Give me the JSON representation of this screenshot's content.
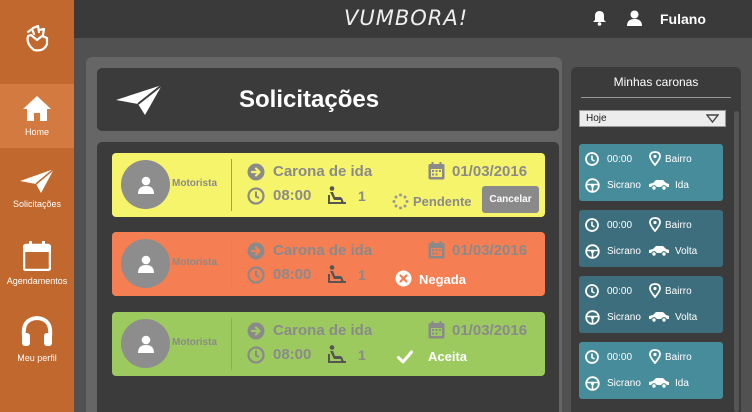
{
  "app": {
    "title": "VUMBORA!"
  },
  "topbar": {
    "user_name": "Fulano"
  },
  "sidebar": {
    "items": [
      {
        "label": "Home",
        "icon": "home-icon"
      },
      {
        "label": "Solicitações",
        "icon": "paper-plane-icon"
      },
      {
        "label": "Agendamentos",
        "icon": "calendar-icon"
      },
      {
        "label": "Meu perfil",
        "icon": "profile-icon"
      }
    ]
  },
  "page": {
    "title": "Solicitações"
  },
  "requests": [
    {
      "driver": "Motorista",
      "ride_type": "Carona de ida",
      "date": "01/03/2016",
      "time": "08:00",
      "seats": "1",
      "status": "Pendente",
      "cancel_label": "Cancelar",
      "color": "#f6f46a"
    },
    {
      "driver": "Motorista",
      "ride_type": "Carona de ida",
      "date": "01/03/2016",
      "time": "08:00",
      "seats": "1",
      "status": "Negada",
      "color": "#f57f52"
    },
    {
      "driver": "Motorista",
      "ride_type": "Carona de ida",
      "date": "01/03/2016",
      "time": "08:00",
      "seats": "1",
      "status": "Aceita",
      "color": "#9cca5e"
    }
  ],
  "my_rides": {
    "title": "Minhas caronas",
    "filter": "Hoje",
    "items": [
      {
        "time": "00:00",
        "place": "Bairro",
        "driver": "Sicrano",
        "direction": "Ida",
        "color": "#478c9b"
      },
      {
        "time": "00:00",
        "place": "Bairro",
        "driver": "Sicrano",
        "direction": "Volta",
        "color": "#3d6e7d"
      },
      {
        "time": "00:00",
        "place": "Bairro",
        "driver": "Sicrano",
        "direction": "Volta",
        "color": "#3d6e7d"
      },
      {
        "time": "00:00",
        "place": "Bairro",
        "driver": "Sicrano",
        "direction": "Ida",
        "color": "#478c9b"
      }
    ]
  }
}
